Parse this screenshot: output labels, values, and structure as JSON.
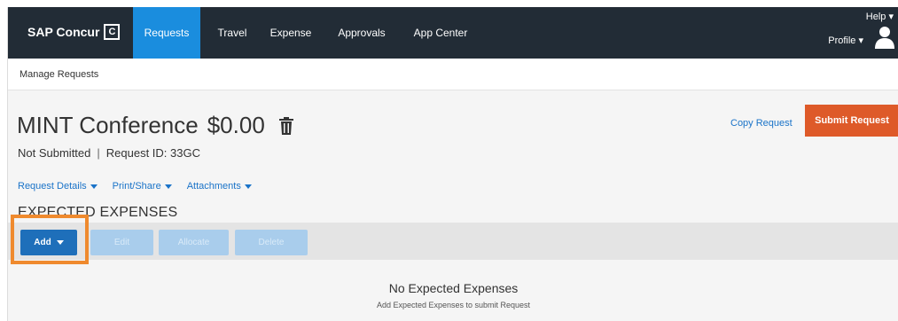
{
  "nav": {
    "brand": "SAP Concur",
    "brand_mark": "C",
    "tabs": [
      {
        "label": "Requests",
        "active": true
      },
      {
        "label": "Travel",
        "active": false
      },
      {
        "label": "Expense",
        "active": false
      },
      {
        "label": "Approvals",
        "active": false
      },
      {
        "label": "App Center",
        "active": false
      }
    ],
    "help": "Help ▾",
    "profile": "Profile ▾"
  },
  "subnav": {
    "label": "Manage Requests"
  },
  "request": {
    "name": "MINT Conference",
    "amount": "$0.00",
    "status": "Not Submitted",
    "separator": "|",
    "request_id": "Request ID: 33GC"
  },
  "actions": {
    "copy": "Copy Request",
    "submit": "Submit Request"
  },
  "detail_tabs": [
    "Request Details",
    "Print/Share",
    "Attachments"
  ],
  "section": {
    "heading": "EXPECTED EXPENSES"
  },
  "toolbar": {
    "add": "Add",
    "edit": "Edit",
    "allocate": "Allocate",
    "delete": "Delete"
  },
  "empty": {
    "title": "No Expected Expenses",
    "subtitle": "Add Expected Expenses to submit Request"
  },
  "colors": {
    "nav_bg": "#222c36",
    "nav_active": "#1a8dde",
    "submit": "#de5a29",
    "link": "#1a73c8",
    "highlight": "#ef8a2e"
  }
}
